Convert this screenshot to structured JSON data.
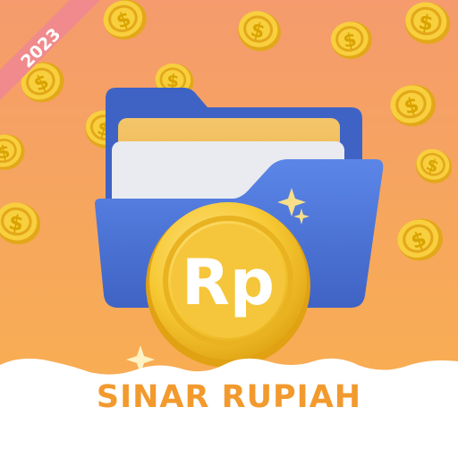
{
  "app": {
    "year_badge": "2023",
    "coin_label": "Rp",
    "title": "SINAR RUPIAH",
    "background_top_color": "#f59b6d",
    "background_bottom_color": "#f8b04e",
    "title_color": "#f29a2e",
    "folder_color": "#4a73d6",
    "coin_color": "#f6c833"
  },
  "decor": {
    "dollar_symbol": "$",
    "coin_icon": "dollar-coin-icon",
    "sparkle_icon": "sparkle-icon",
    "folder_icon": "folder-icon"
  }
}
